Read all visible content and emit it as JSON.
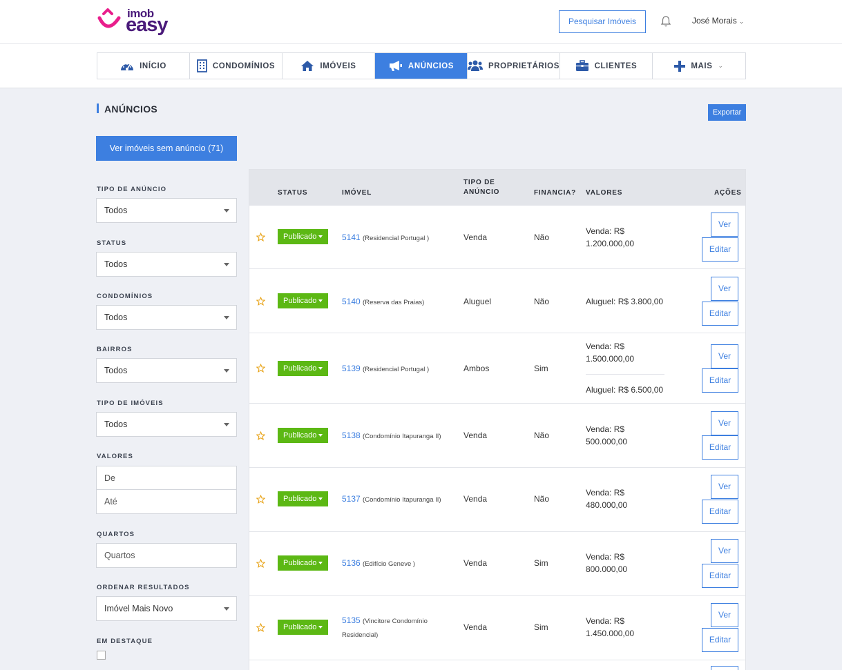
{
  "header": {
    "logo_top": "imob",
    "logo_bottom": "easy",
    "search_button": "Pesquisar Imóveis",
    "user_name": "José Morais"
  },
  "nav": [
    {
      "label": "INÍCIO",
      "icon": "dashboard-icon"
    },
    {
      "label": "CONDOMÍNIOS",
      "icon": "building-icon"
    },
    {
      "label": "IMÓVEIS",
      "icon": "home-icon"
    },
    {
      "label": "ANÚNCIOS",
      "icon": "megaphone-icon",
      "active": true
    },
    {
      "label": "PROPRIETÁRIOS",
      "icon": "users-icon"
    },
    {
      "label": "CLIENTES",
      "icon": "briefcase-icon"
    },
    {
      "label": "MAIS",
      "icon": "plus-icon"
    }
  ],
  "page": {
    "title": "ANÚNCIOS",
    "export_button": "Exportar",
    "without_ad_button": "Ver imóveis sem anúncio (71)"
  },
  "filters": {
    "tipo_anuncio": {
      "label": "TIPO DE ANÚNCIO",
      "value": "Todos"
    },
    "status": {
      "label": "STATUS",
      "value": "Todos"
    },
    "condominios": {
      "label": "CONDOMÍNIOS",
      "value": "Todos"
    },
    "bairros": {
      "label": "BAIRROS",
      "value": "Todos"
    },
    "tipo_imoveis": {
      "label": "TIPO DE IMÓVEIS",
      "value": "Todos"
    },
    "valores": {
      "label": "VALORES",
      "from_placeholder": "De",
      "to_placeholder": "Até"
    },
    "quartos": {
      "label": "QUARTOS",
      "placeholder": "Quartos"
    },
    "ordenar": {
      "label": "ORDENAR RESULTADOS",
      "value": "Imóvel Mais Novo"
    },
    "destaque": {
      "label": "EM DESTAQUE"
    }
  },
  "table": {
    "headers": {
      "status": "STATUS",
      "imovel": "IMÓVEL",
      "tipo": "TIPO DE ANÚNCIO",
      "financia": "FINANCIA?",
      "valores": "VALORES",
      "acoes": "AÇÕES"
    },
    "ver_label": "Ver",
    "editar_label": "Editar",
    "rows": [
      {
        "status": "Publicado",
        "code": "5141",
        "name": "(Residencial Portugal )",
        "tipo": "Venda",
        "financia": "Não",
        "valor1": "Venda: R$ 1.200.000,00",
        "valor2": ""
      },
      {
        "status": "Publicado",
        "code": "5140",
        "name": "(Reserva das Praias)",
        "tipo": "Aluguel",
        "financia": "Não",
        "valor1": "Aluguel: R$ 3.800,00",
        "valor2": ""
      },
      {
        "status": "Publicado",
        "code": "5139",
        "name": "(Residencial Portugal )",
        "tipo": "Ambos",
        "financia": "Sim",
        "valor1": "Venda: R$ 1.500.000,00",
        "valor2": "Aluguel: R$ 6.500,00"
      },
      {
        "status": "Publicado",
        "code": "5138",
        "name": "(Condomínio Itapuranga II)",
        "tipo": "Venda",
        "financia": "Não",
        "valor1": "Venda: R$ 500.000,00",
        "valor2": ""
      },
      {
        "status": "Publicado",
        "code": "5137",
        "name": "(Condomínio Itapuranga II)",
        "tipo": "Venda",
        "financia": "Não",
        "valor1": "Venda: R$ 480.000,00",
        "valor2": ""
      },
      {
        "status": "Publicado",
        "code": "5136",
        "name": "(Edifício Geneve )",
        "tipo": "Venda",
        "financia": "Sim",
        "valor1": "Venda: R$ 800.000,00",
        "valor2": ""
      },
      {
        "status": "Publicado",
        "code": "5135",
        "name": "(Vincitore Condomínio Residencial)",
        "tipo": "Venda",
        "financia": "Sim",
        "valor1": "Venda: R$ 1.450.000,00",
        "valor2": ""
      }
    ]
  }
}
